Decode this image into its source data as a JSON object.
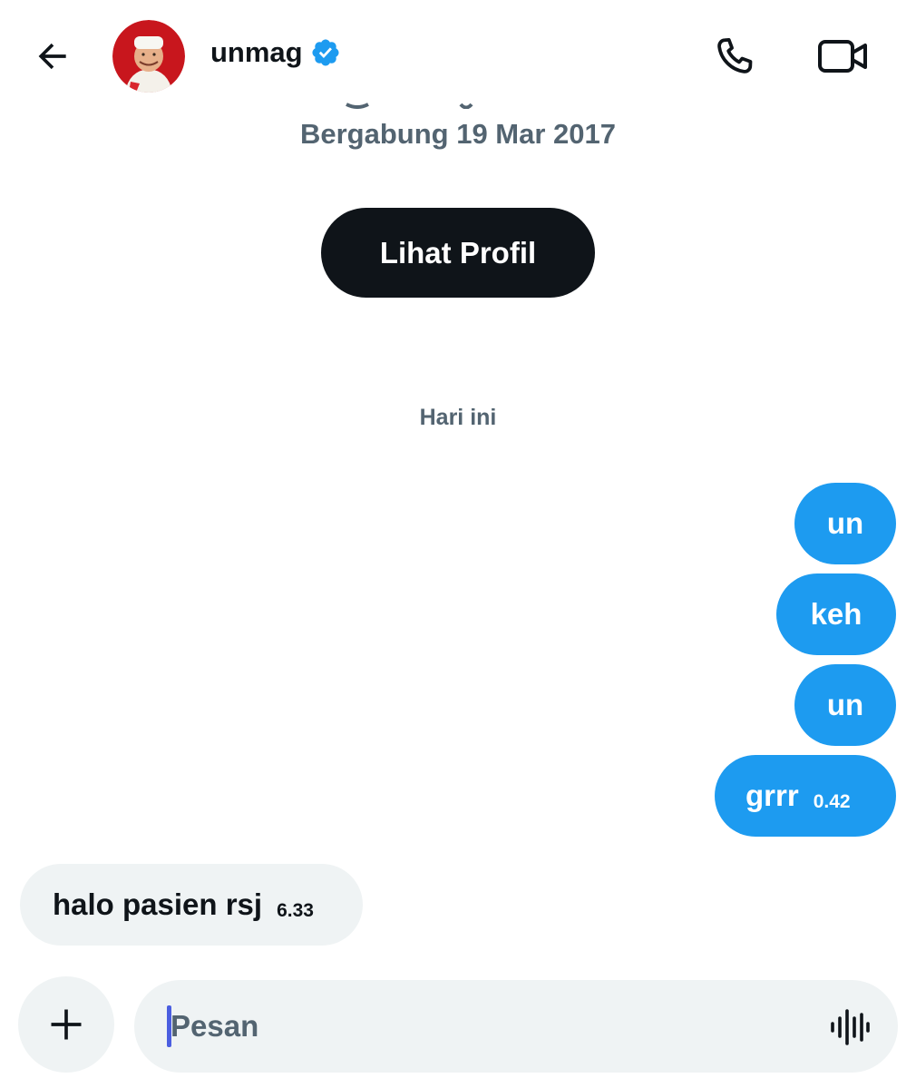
{
  "header": {
    "username": "unmag",
    "verified_color": "#1d9bf0",
    "icons": [
      "arrow-left-icon",
      "phone-icon",
      "video-camera-icon",
      "verified-badge-icon"
    ]
  },
  "profile": {
    "joined_text": "Bergabung 19 Mar 2017",
    "view_profile_label": "Lihat Profil"
  },
  "day_separator": "Hari ini",
  "messages_out": [
    {
      "text": "un"
    },
    {
      "text": "keh"
    },
    {
      "text": "un"
    },
    {
      "text": "grrr",
      "time": "0.42"
    }
  ],
  "messages_in": [
    {
      "text": "halo pasien rsj",
      "time": "6.33"
    }
  ],
  "composer": {
    "placeholder": "Pesan",
    "icons": [
      "plus-icon",
      "voice-wave-icon"
    ]
  },
  "colors": {
    "accent": "#1d9bf0",
    "dark_button": "#0f1419",
    "muted_text": "#536471",
    "bubble_in": "#eff3f4"
  }
}
